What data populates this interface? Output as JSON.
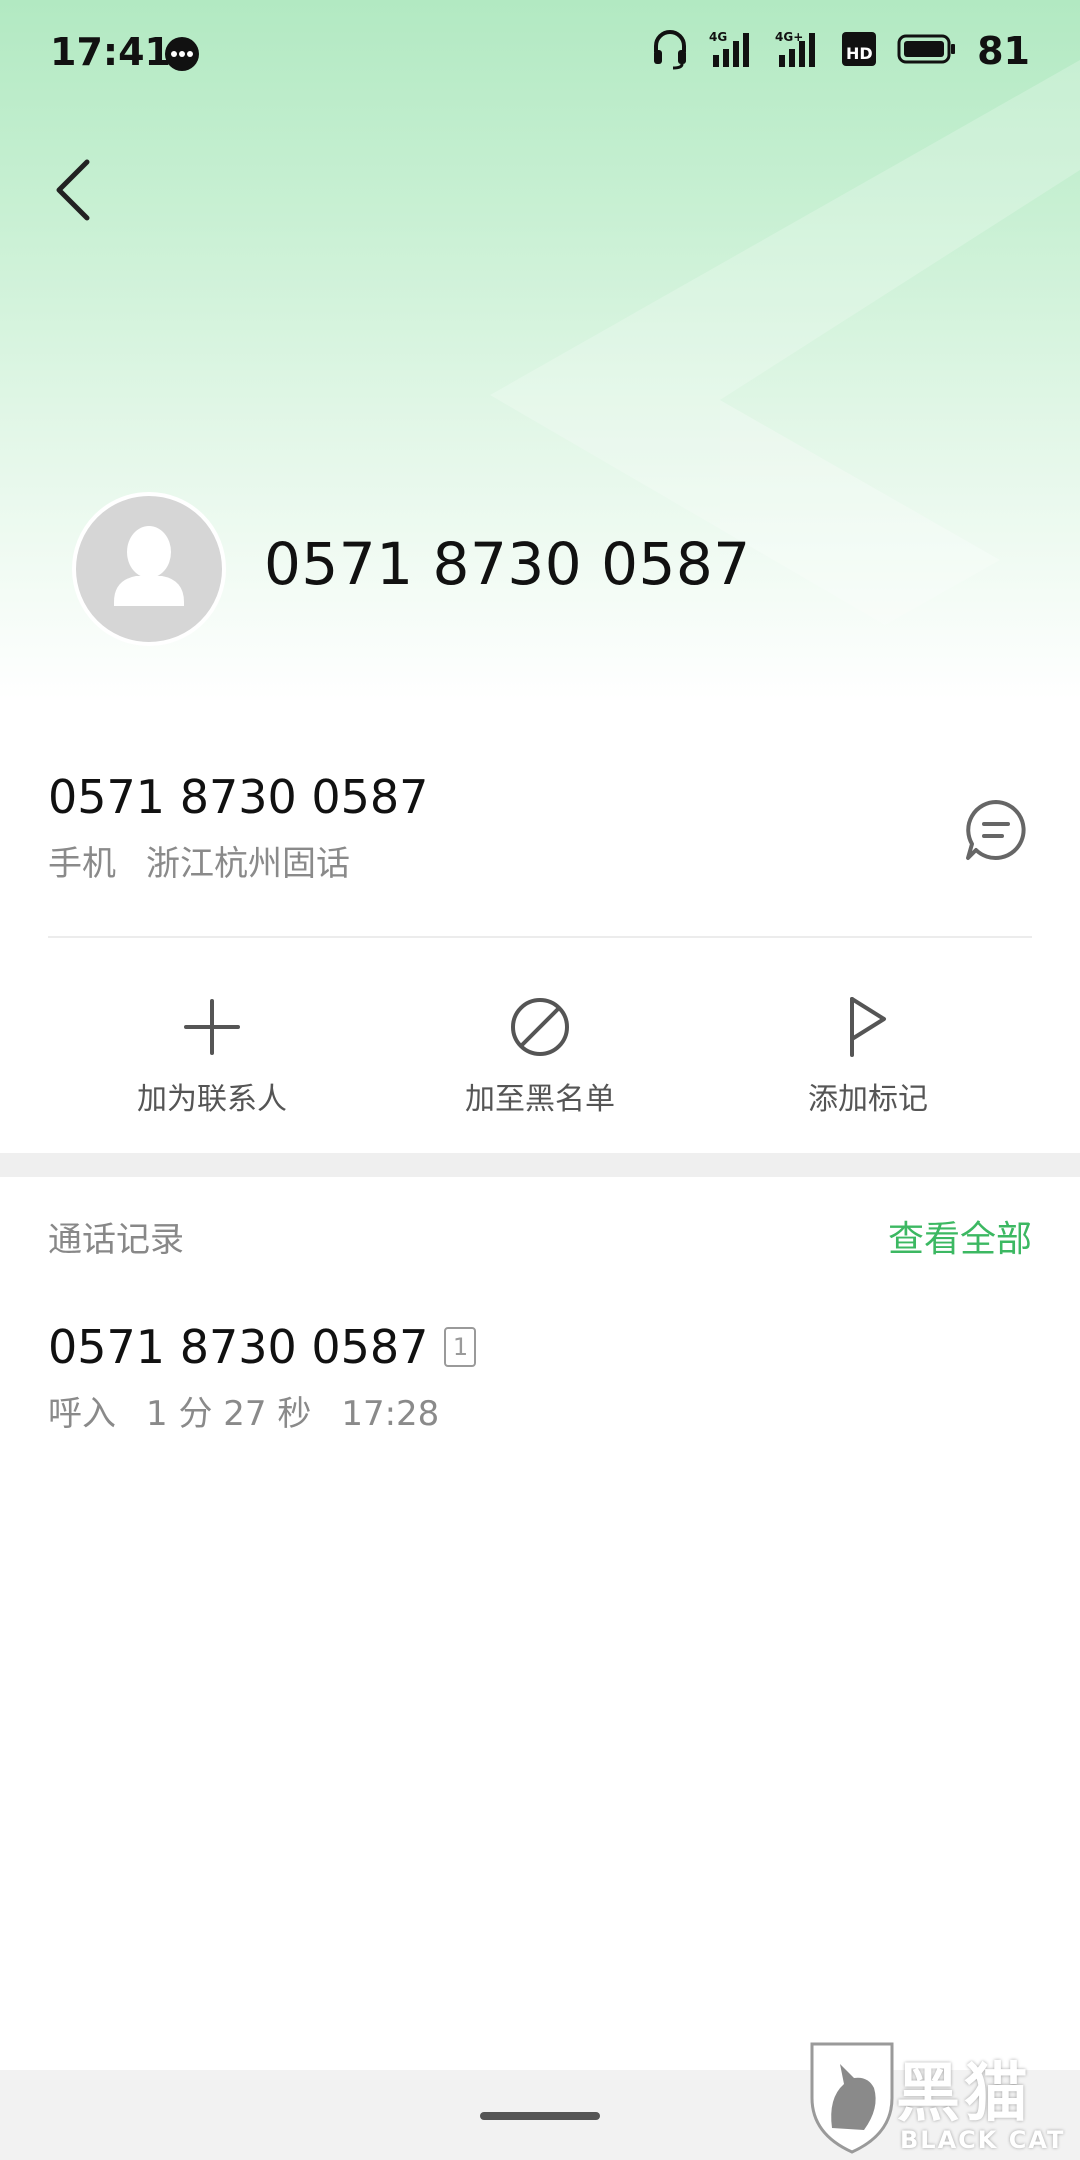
{
  "status_bar": {
    "time": "17:41",
    "battery": "81",
    "network_1": "4G",
    "network_2": "4G+",
    "icons": [
      "message-bubble-icon",
      "headset-icon",
      "signal-4g-icon",
      "signal-4g-plus-icon",
      "hd-call-icon",
      "battery-icon"
    ]
  },
  "header": {
    "phone_number": "0571 8730 0587",
    "accent_color": "#b2e9c2"
  },
  "number_detail": {
    "number": "0571 8730 0587",
    "type": "手机",
    "location": "浙江杭州固话"
  },
  "actions": [
    {
      "label": "加为联系人",
      "icon": "plus-icon"
    },
    {
      "label": "加至黑名单",
      "icon": "block-icon"
    },
    {
      "label": "添加标记",
      "icon": "flag-icon"
    }
  ],
  "call_log": {
    "title": "通话记录",
    "view_all": "查看全部",
    "view_all_color": "#3cb862",
    "entries": [
      {
        "number": "0571 8730 0587",
        "sim": "1",
        "direction": "呼入",
        "duration": "1 分 27 秒",
        "time": "17:28"
      }
    ]
  },
  "watermark": {
    "text_cn": "黑猫",
    "text_en": "BLACK CAT"
  }
}
